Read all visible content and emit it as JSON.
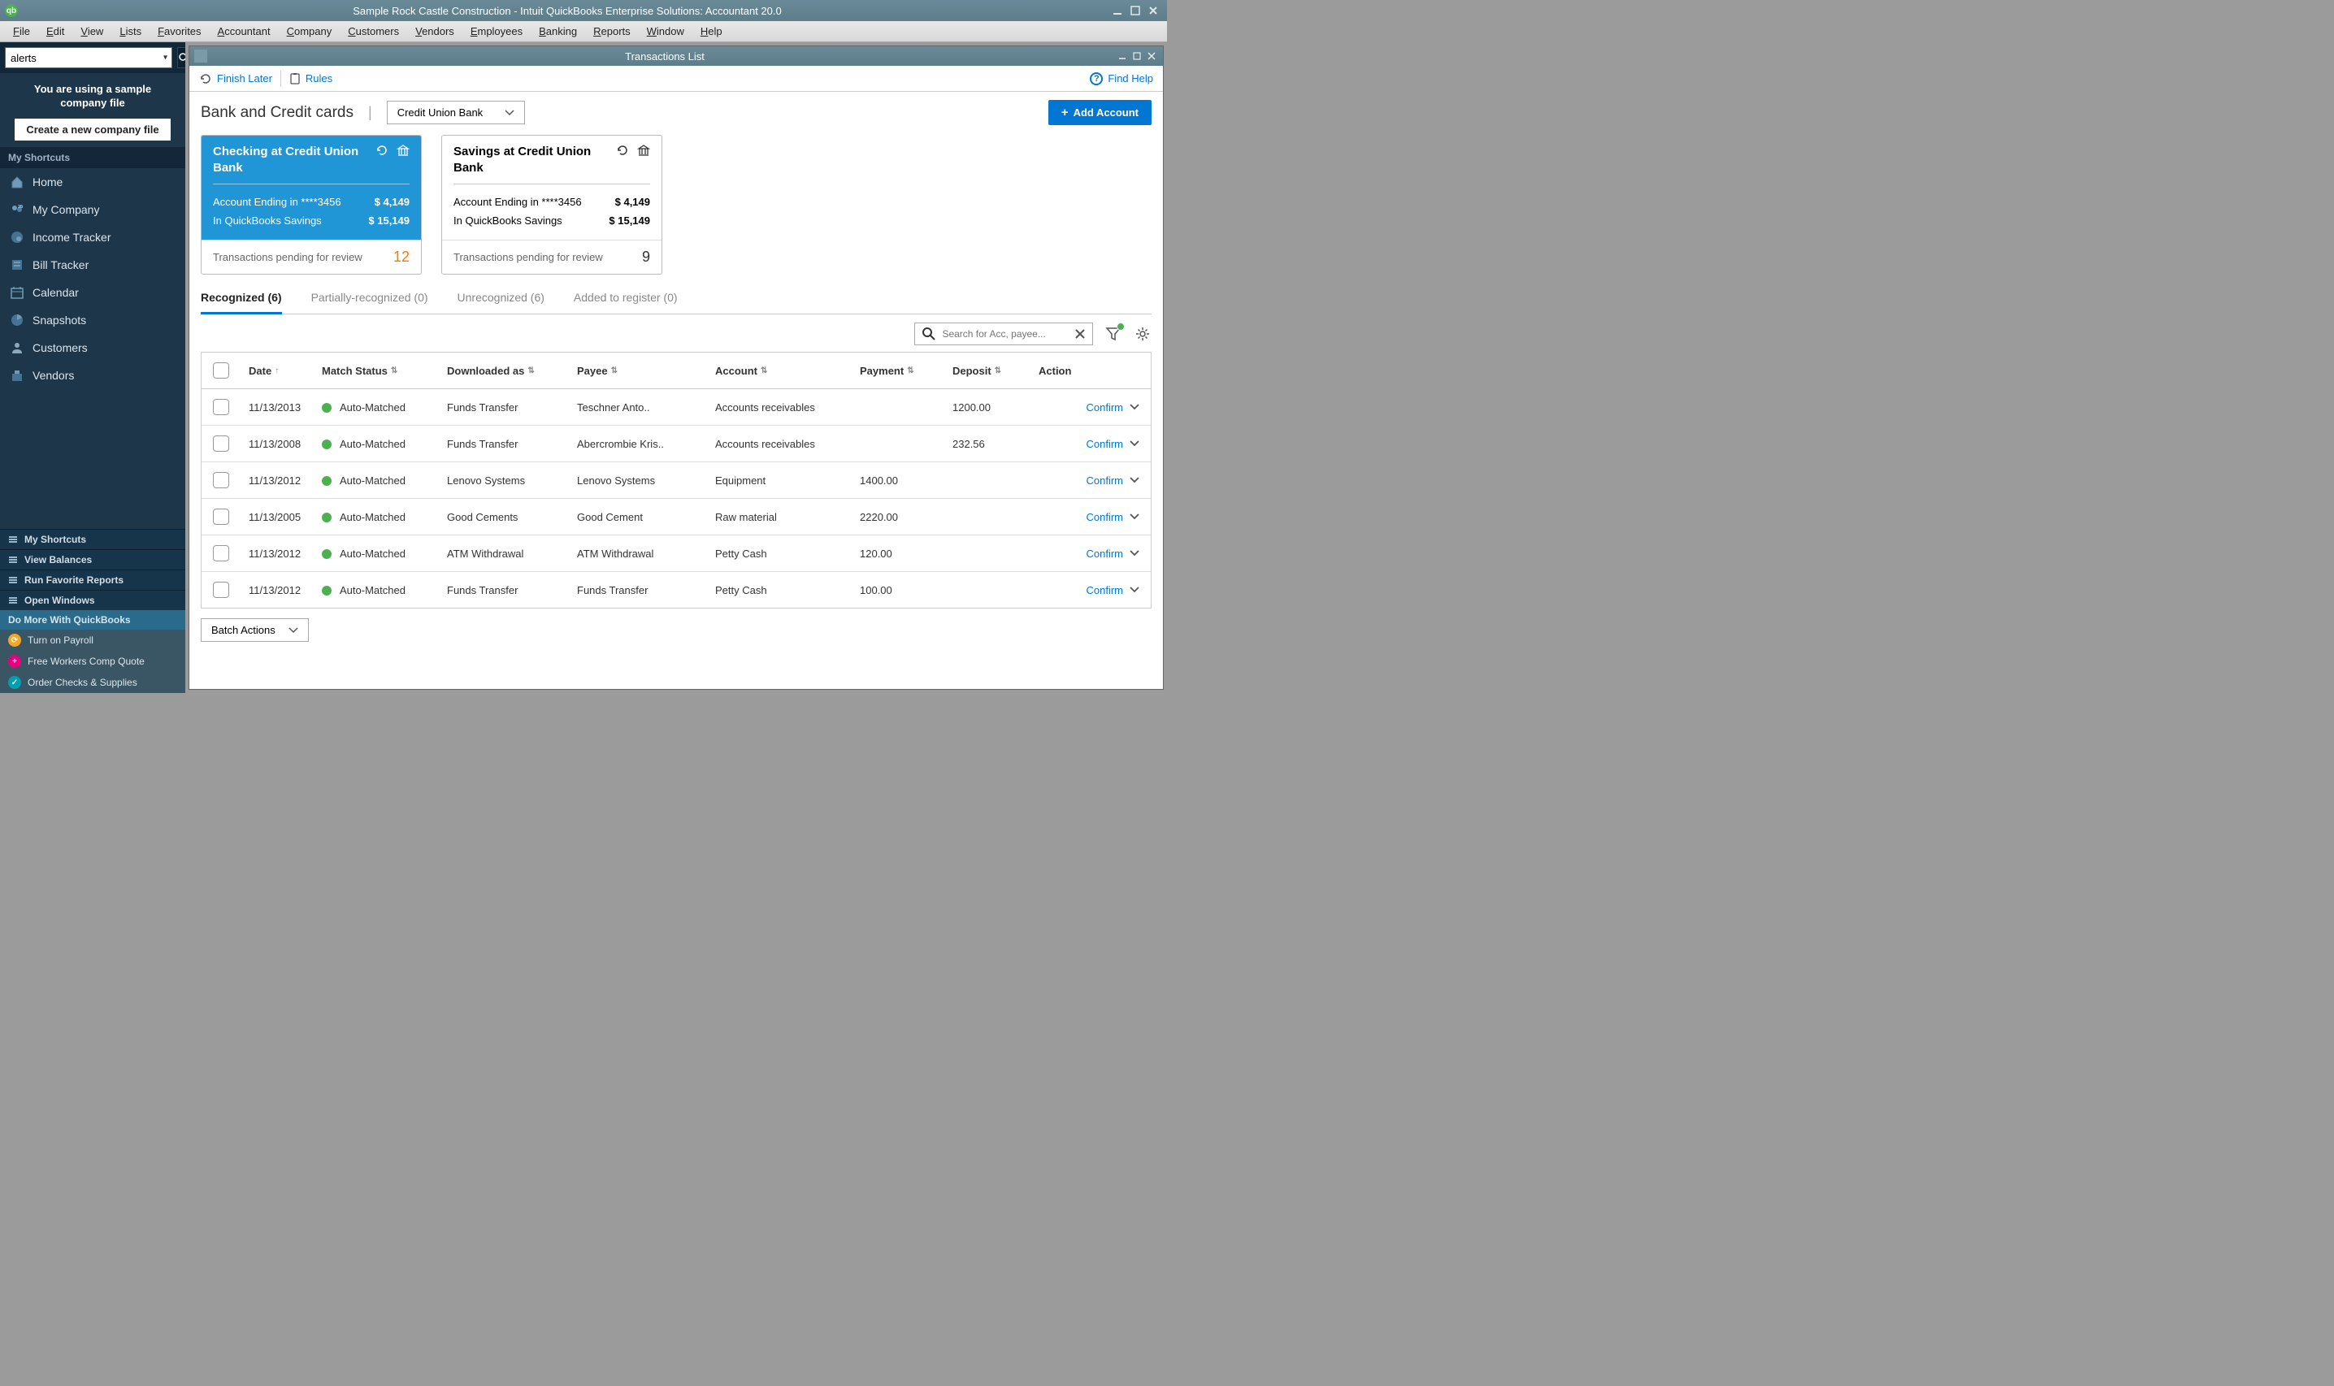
{
  "titlebar": {
    "title": "Sample Rock Castle Construction  - Intuit QuickBooks Enterprise Solutions: Accountant 20.0"
  },
  "menu": [
    "File",
    "Edit",
    "View",
    "Lists",
    "Favorites",
    "Accountant",
    "Company",
    "Customers",
    "Vendors",
    "Employees",
    "Banking",
    "Reports",
    "Window",
    "Help"
  ],
  "sidebar": {
    "search_value": "alerts",
    "sample_msg_line1": "You are using a sample",
    "sample_msg_line2": "company file",
    "create_btn": "Create a new company file",
    "shortcuts_header": "My Shortcuts",
    "shortcuts": [
      {
        "label": "Home"
      },
      {
        "label": "My Company"
      },
      {
        "label": "Income Tracker"
      },
      {
        "label": "Bill Tracker"
      },
      {
        "label": "Calendar"
      },
      {
        "label": "Snapshots"
      },
      {
        "label": "Customers"
      },
      {
        "label": "Vendors"
      }
    ],
    "bottom_nav": [
      "My Shortcuts",
      "View Balances",
      "Run Favorite Reports",
      "Open Windows"
    ],
    "do_more_header": "Do More With QuickBooks",
    "do_more": [
      "Turn on Payroll",
      "Free Workers Comp Quote",
      "Order Checks & Supplies"
    ]
  },
  "window": {
    "title": "Transactions List",
    "toolbar": {
      "finish_later": "Finish Later",
      "rules": "Rules",
      "find_help": "Find Help"
    },
    "page_title": "Bank and Credit cards",
    "account_selected": "Credit Union Bank",
    "add_account_label": "Add Account",
    "cards": [
      {
        "name": "Checking at Credit Union Bank",
        "ending_label": "Account Ending in ****3456",
        "ending_val": "$ 4,149",
        "qb_label": "In QuickBooks Savings",
        "qb_val": "$ 15,149",
        "pending_label": "Transactions pending for review",
        "pending_count": "12",
        "active": true
      },
      {
        "name": "Savings at Credit Union Bank",
        "ending_label": "Account Ending in ****3456",
        "ending_val": "$ 4,149",
        "qb_label": "In QuickBooks Savings",
        "qb_val": "$ 15,149",
        "pending_label": "Transactions pending for review",
        "pending_count": "9",
        "active": false
      }
    ],
    "tabs": [
      {
        "label": "Recognized  (6)",
        "active": true
      },
      {
        "label": "Partially-recognized (0)",
        "active": false
      },
      {
        "label": "Unrecognized  (6)",
        "active": false
      },
      {
        "label": "Added to register (0)",
        "active": false
      }
    ],
    "search_placeholder": "Search for Acc, payee...",
    "columns": {
      "date": "Date",
      "match": "Match Status",
      "downloaded": "Downloaded as",
      "payee": "Payee",
      "account": "Account",
      "payment": "Payment",
      "deposit": "Deposit",
      "action": "Action"
    },
    "rows": [
      {
        "date": "11/13/2013",
        "match": "Auto-Matched",
        "downloaded": "Funds Transfer",
        "payee": "Teschner Anto..",
        "account": "Accounts receivables",
        "payment": "",
        "deposit": "1200.00",
        "action": "Confirm"
      },
      {
        "date": "11/13/2008",
        "match": "Auto-Matched",
        "downloaded": "Funds Transfer",
        "payee": "Abercrombie Kris..",
        "account": "Accounts receivables",
        "payment": "",
        "deposit": "232.56",
        "action": "Confirm"
      },
      {
        "date": "11/13/2012",
        "match": "Auto-Matched",
        "downloaded": "Lenovo Systems",
        "payee": "Lenovo Systems",
        "account": "Equipment",
        "payment": "1400.00",
        "deposit": "",
        "action": "Confirm"
      },
      {
        "date": "11/13/2005",
        "match": "Auto-Matched",
        "downloaded": "Good Cements",
        "payee": "Good Cement",
        "account": "Raw material",
        "payment": "2220.00",
        "deposit": "",
        "action": "Confirm"
      },
      {
        "date": "11/13/2012",
        "match": "Auto-Matched",
        "downloaded": "ATM Withdrawal",
        "payee": "ATM Withdrawal",
        "account": "Petty Cash",
        "payment": "120.00",
        "deposit": "",
        "action": "Confirm"
      },
      {
        "date": "11/13/2012",
        "match": "Auto-Matched",
        "downloaded": "Funds Transfer",
        "payee": "Funds Transfer",
        "account": "Petty Cash",
        "payment": "100.00",
        "deposit": "",
        "action": "Confirm"
      }
    ],
    "batch_actions_label": "Batch Actions"
  }
}
